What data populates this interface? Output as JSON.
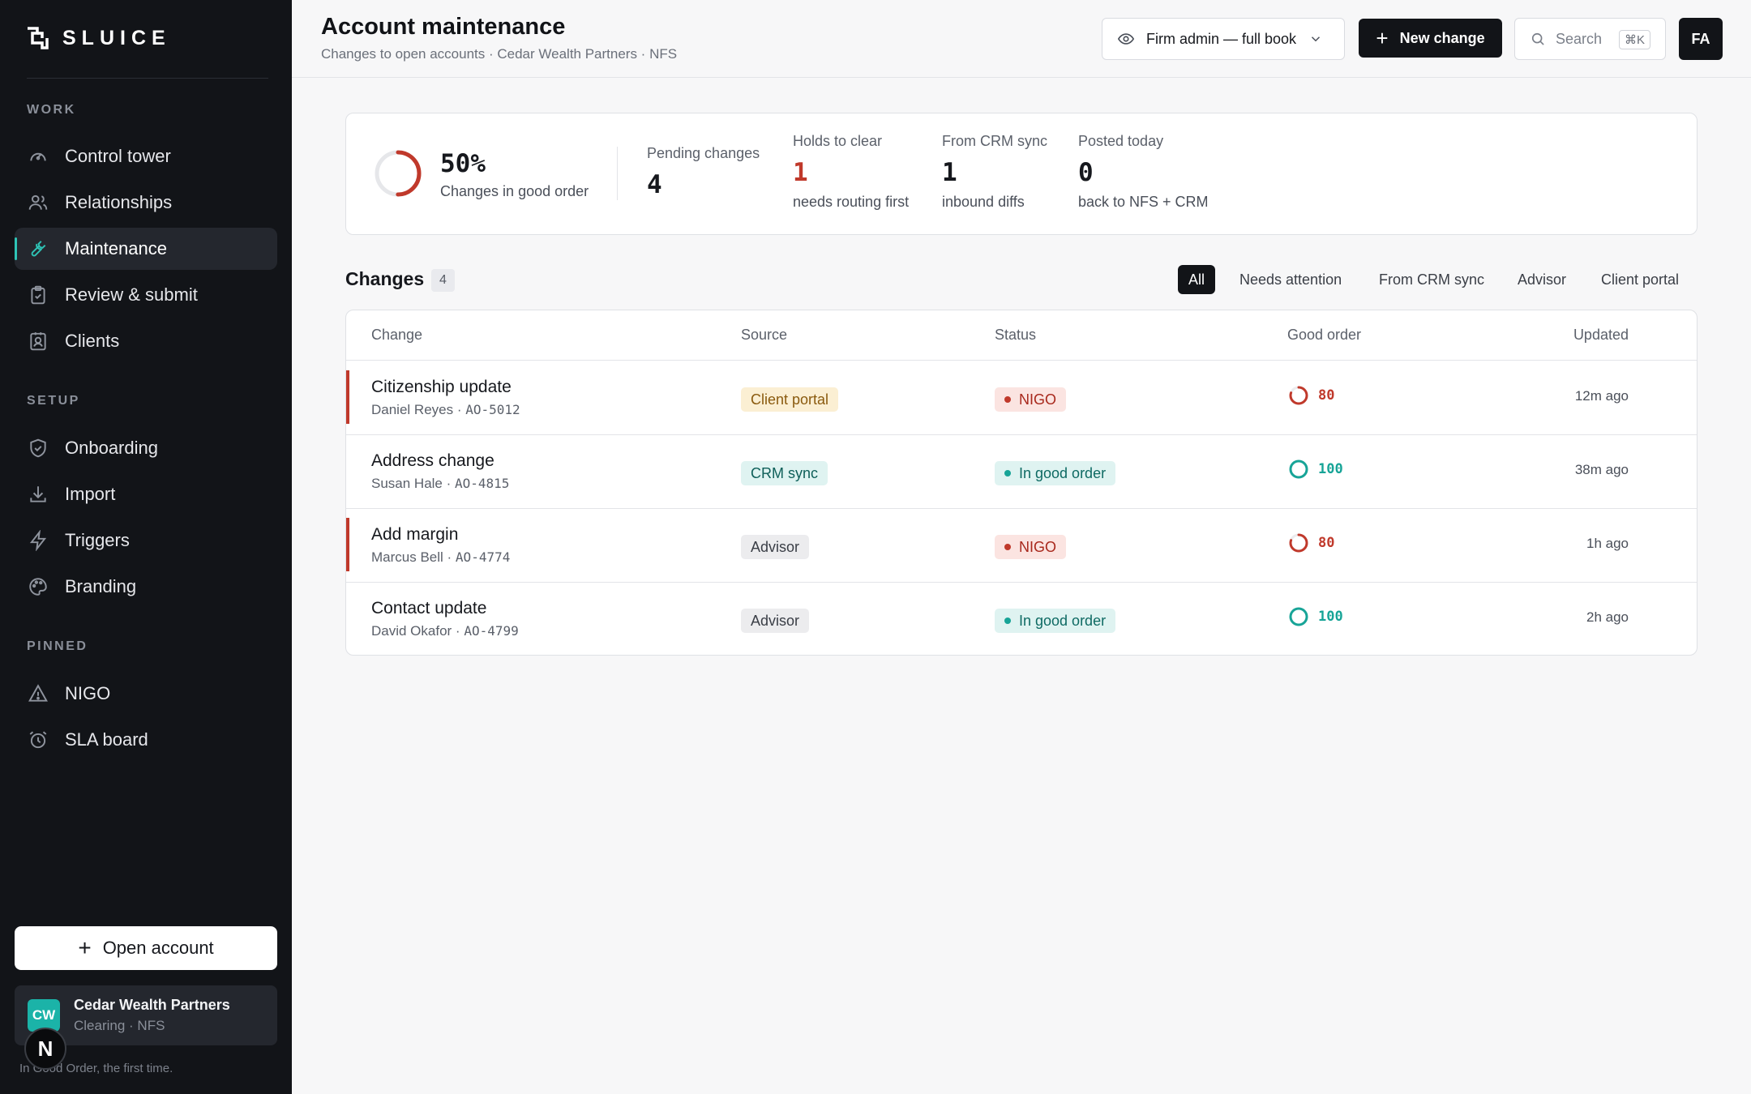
{
  "brand": {
    "name": "SLUICE"
  },
  "sidebar": {
    "sections": [
      {
        "label": "WORK"
      },
      {
        "label": "SETUP"
      },
      {
        "label": "PINNED"
      }
    ],
    "work_items": [
      {
        "label": "Control tower",
        "icon": "gauge-icon"
      },
      {
        "label": "Relationships",
        "icon": "users-icon"
      },
      {
        "label": "Maintenance",
        "icon": "wrench-icon",
        "active": true
      },
      {
        "label": "Review & submit",
        "icon": "clipboard-check-icon"
      },
      {
        "label": "Clients",
        "icon": "contact-card-icon"
      }
    ],
    "setup_items": [
      {
        "label": "Onboarding",
        "icon": "shield-check-icon"
      },
      {
        "label": "Import",
        "icon": "download-icon"
      },
      {
        "label": "Triggers",
        "icon": "bolt-icon"
      },
      {
        "label": "Branding",
        "icon": "palette-icon"
      }
    ],
    "pinned_items": [
      {
        "label": "NIGO",
        "icon": "warning-icon"
      },
      {
        "label": "SLA board",
        "icon": "alarm-clock-icon"
      }
    ],
    "open_account_label": "Open account",
    "org": {
      "initials": "CW",
      "name": "Cedar Wealth Partners",
      "sub": "Clearing · NFS"
    },
    "n_badge": "N",
    "tagline": "In Good Order, the first time."
  },
  "header": {
    "title": "Account maintenance",
    "subtitle": "Changes to open accounts · Cedar Wealth Partners · NFS",
    "view_label": "Firm admin — full book",
    "new_change_label": "New change",
    "search_label": "Search",
    "search_shortcut": "⌘K",
    "user_initials": "FA"
  },
  "stats": {
    "good_order_pct": "50%",
    "good_order_fraction": 0.5,
    "good_order_label": "Changes in good order",
    "items": [
      {
        "label": "Pending changes",
        "value": "4",
        "note": ""
      },
      {
        "label": "Holds to clear",
        "value": "1",
        "note": "needs routing first"
      },
      {
        "label": "From CRM sync",
        "value": "1",
        "note": "inbound diffs"
      },
      {
        "label": "Posted today",
        "value": "0",
        "note": "back to NFS + CRM"
      }
    ]
  },
  "changes": {
    "title": "Changes",
    "count": "4",
    "filters": [
      "All",
      "Needs attention",
      "From CRM sync",
      "Advisor",
      "Client portal"
    ],
    "active_filter": "All",
    "columns": {
      "change": "Change",
      "source": "Source",
      "status": "Status",
      "good_order": "Good order",
      "updated": "Updated"
    },
    "rows": [
      {
        "title": "Citizenship update",
        "client": "Daniel Reyes",
        "id": "AO-5012",
        "source": "Client portal",
        "source_kind": "portal",
        "status": "NIGO",
        "status_kind": "nigo",
        "score": "80",
        "score_fraction": 0.8,
        "updated": "12m ago",
        "flagged": true
      },
      {
        "title": "Address change",
        "client": "Susan Hale",
        "id": "AO-4815",
        "source": "CRM sync",
        "source_kind": "crm",
        "status": "In good order",
        "status_kind": "good",
        "score": "100",
        "score_fraction": 1.0,
        "updated": "38m ago",
        "flagged": false
      },
      {
        "title": "Add margin",
        "client": "Marcus Bell",
        "id": "AO-4774",
        "source": "Advisor",
        "source_kind": "advisor",
        "status": "NIGO",
        "status_kind": "nigo",
        "score": "80",
        "score_fraction": 0.8,
        "updated": "1h ago",
        "flagged": true
      },
      {
        "title": "Contact update",
        "client": "David Okafor",
        "id": "AO-4799",
        "source": "Advisor",
        "source_kind": "advisor",
        "status": "In good order",
        "status_kind": "good",
        "score": "100",
        "score_fraction": 1.0,
        "updated": "2h ago",
        "flagged": false
      }
    ]
  },
  "colors": {
    "accent_teal": "#17a497",
    "nigo_red": "#c0392b",
    "sidebar_bg": "#121418"
  }
}
